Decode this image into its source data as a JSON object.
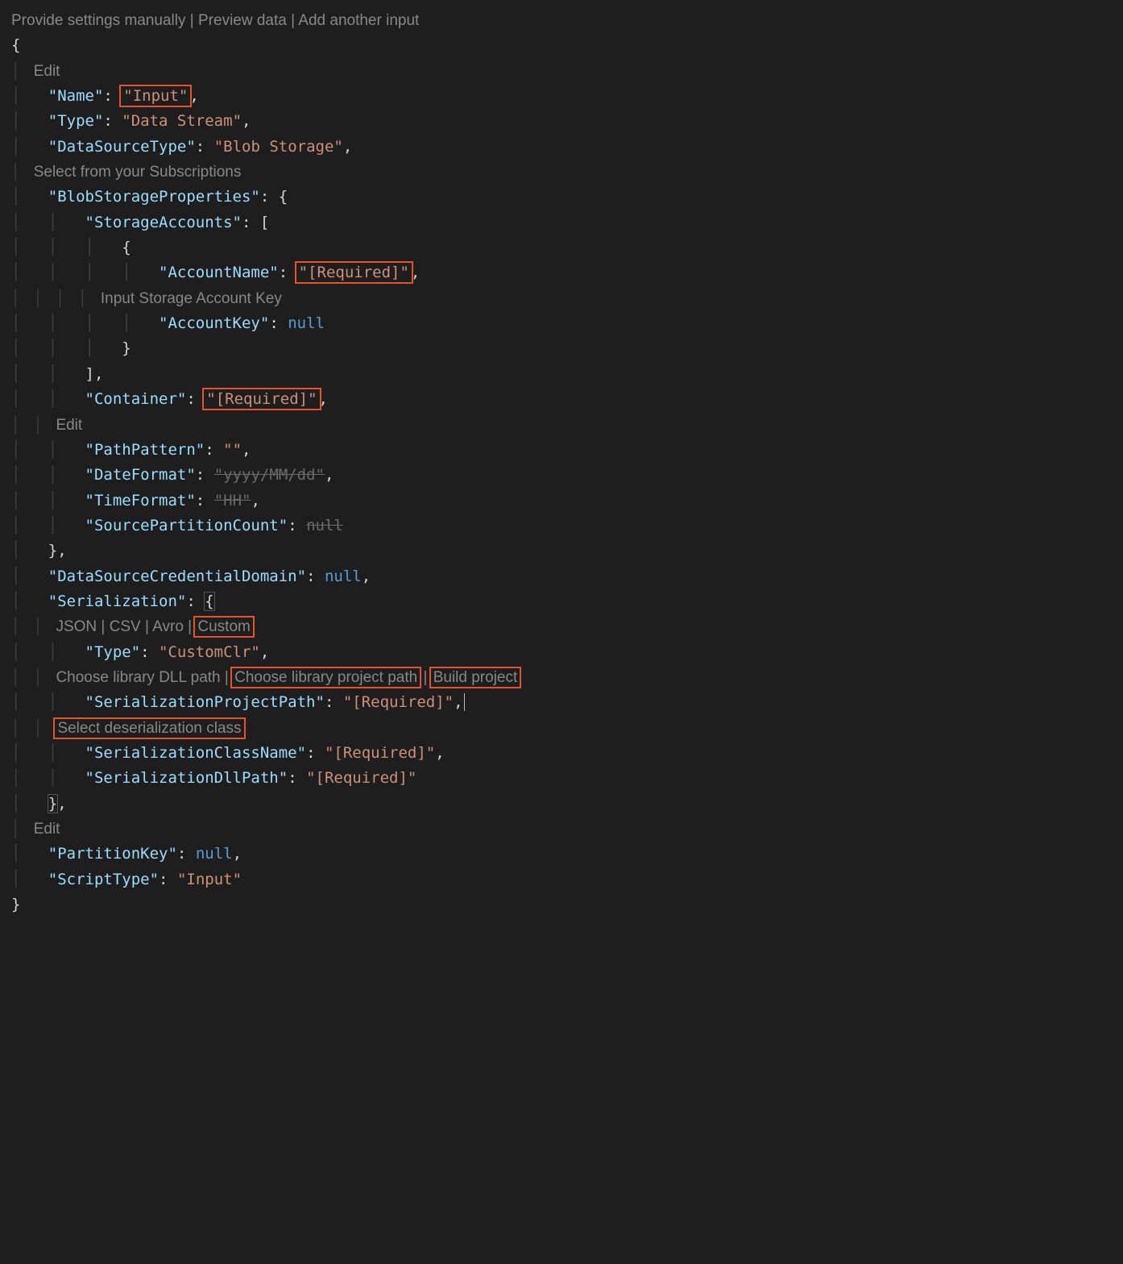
{
  "topHints": {
    "provide": "Provide settings manually",
    "preview": "Preview data",
    "addAnother": "Add another input",
    "sep": " | "
  },
  "hints": {
    "editTop": "Edit",
    "selectSubs": "Select from your Subscriptions",
    "inputKey": "Input Storage Account Key",
    "editPath": "Edit",
    "serialFormats": {
      "json": "JSON",
      "csv": "CSV",
      "avro": "Avro",
      "custom": "Custom",
      "sep": " | "
    },
    "libPaths": {
      "dll": "Choose library DLL path",
      "proj": "Choose library project path",
      "build": "Build project",
      "sep": " | "
    },
    "selectClass": "Select deserialization class",
    "editBottom": "Edit"
  },
  "keys": {
    "Name": "\"Name\"",
    "Type": "\"Type\"",
    "DataSourceType": "\"DataSourceType\"",
    "BlobStorageProperties": "\"BlobStorageProperties\"",
    "StorageAccounts": "\"StorageAccounts\"",
    "AccountName": "\"AccountName\"",
    "AccountKey": "\"AccountKey\"",
    "Container": "\"Container\"",
    "PathPattern": "\"PathPattern\"",
    "DateFormat": "\"DateFormat\"",
    "TimeFormat": "\"TimeFormat\"",
    "SourcePartitionCount": "\"SourcePartitionCount\"",
    "DataSourceCredentialDomain": "\"DataSourceCredentialDomain\"",
    "Serialization": "\"Serialization\"",
    "SerType": "\"Type\"",
    "SerializationProjectPath": "\"SerializationProjectPath\"",
    "SerializationClassName": "\"SerializationClassName\"",
    "SerializationDllPath": "\"SerializationDllPath\"",
    "PartitionKey": "\"PartitionKey\"",
    "ScriptType": "\"ScriptType\""
  },
  "vals": {
    "Name": "\"Input\"",
    "Type": "\"Data Stream\"",
    "DataSourceType": "\"Blob Storage\"",
    "AccountName": "\"[Required]\"",
    "AccountKey": "null",
    "Container": "\"[Required]\"",
    "PathPattern": "\"\"",
    "DateFormat": "\"yyyy/MM/dd\"",
    "TimeFormat": "\"HH\"",
    "SourcePartitionCount": "null",
    "DataSourceCredentialDomain": "null",
    "SerType": "\"CustomClr\"",
    "SerializationProjectPath": "\"[Required]\"",
    "SerializationClassName": "\"[Required]\"",
    "SerializationDllPath": "\"[Required]\"",
    "PartitionKey": "null",
    "ScriptType": "\"Input\""
  },
  "syntax": {
    "openBrace": "{",
    "closeBrace": "}",
    "openBracket": "[",
    "closeBracket": "]",
    "colon": ": ",
    "comma": ",",
    "closeBraceComma": "},",
    "closeBracketComma": "],"
  },
  "indent": {
    "i1": "    ",
    "i2": "        ",
    "i3": "            ",
    "i4": "                "
  }
}
